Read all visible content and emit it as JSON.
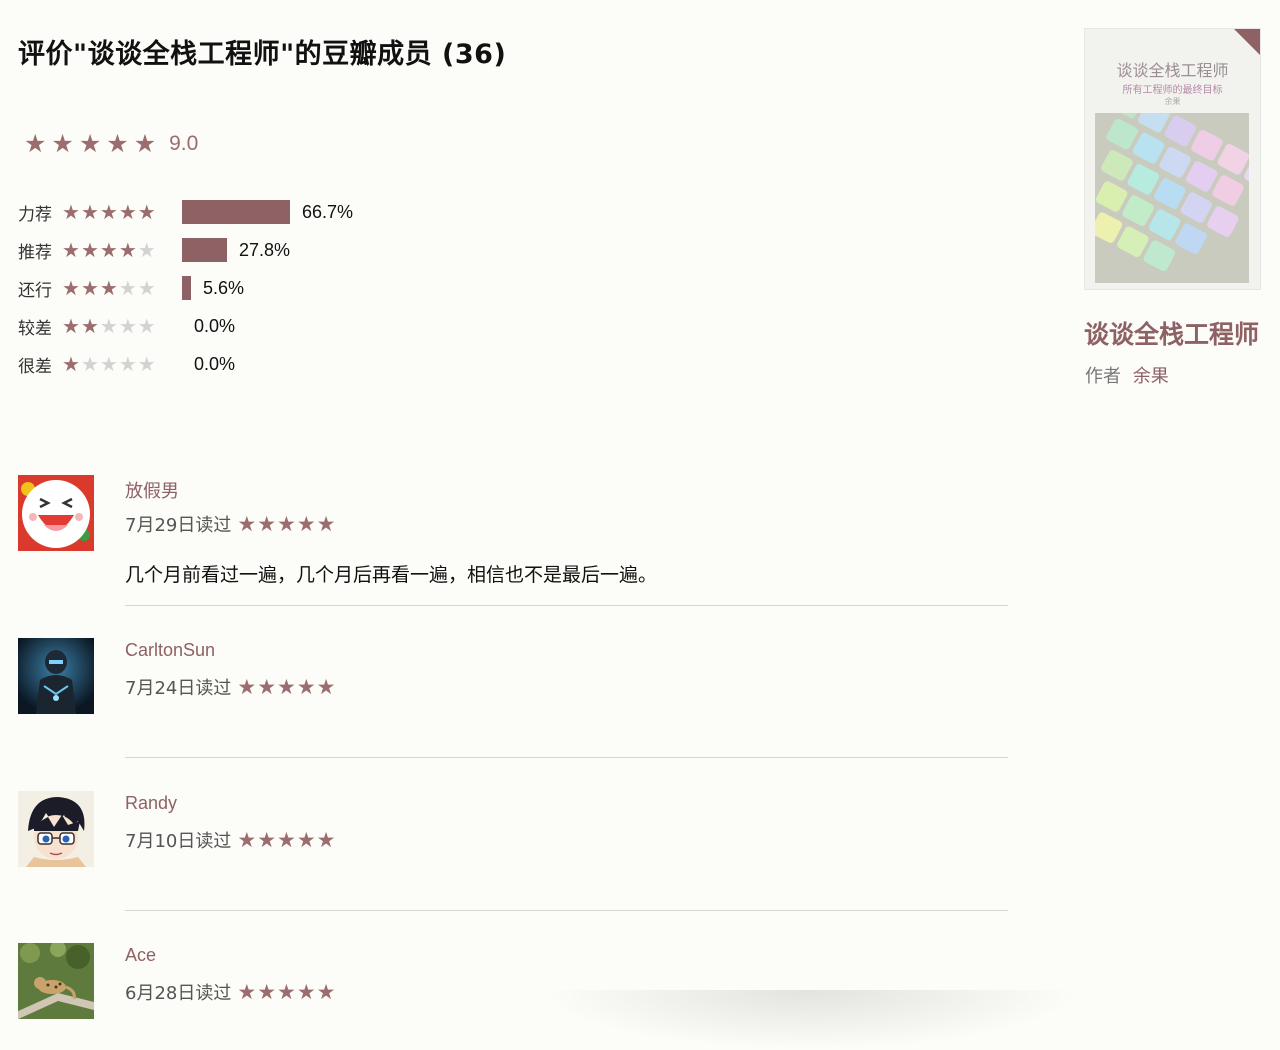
{
  "page": {
    "title": "评价\"谈谈全栈工程师\"的豆瓣成员 (36)"
  },
  "rating": {
    "average": "9.0",
    "average_stars": 5,
    "distribution": [
      {
        "label": "力荐",
        "stars": 5,
        "percent_text": "66.7%",
        "fraction": 0.667
      },
      {
        "label": "推荐",
        "stars": 4,
        "percent_text": "27.8%",
        "fraction": 0.278
      },
      {
        "label": "还行",
        "stars": 3,
        "percent_text": "5.6%",
        "fraction": 0.056
      },
      {
        "label": "较差",
        "stars": 2,
        "percent_text": "0.0%",
        "fraction": 0.0
      },
      {
        "label": "很差",
        "stars": 1,
        "percent_text": "0.0%",
        "fraction": 0.0
      }
    ]
  },
  "reviews": [
    {
      "user": "放假男",
      "date": "7月29日读过",
      "stars": 5,
      "comment": "几个月前看过一遍，几个月后再看一遍，相信也不是最后一遍。",
      "avatar_icon": "laughing-face-avatar"
    },
    {
      "user": "CarltonSun",
      "date": "7月24日读过",
      "stars": 5,
      "comment": "",
      "avatar_icon": "armored-soldier-avatar"
    },
    {
      "user": "Randy",
      "date": "7月10日读过",
      "stars": 5,
      "comment": "",
      "avatar_icon": "anime-boy-avatar"
    },
    {
      "user": "Ace",
      "date": "6月28日读过",
      "stars": 5,
      "comment": "",
      "avatar_icon": "leopard-on-branch-avatar"
    }
  ],
  "book": {
    "cover_title": "谈谈全栈工程师",
    "cover_subtitle": "所有工程师的最终目标",
    "cover_author": "余果",
    "title": "谈谈全栈工程师",
    "author_label": "作者",
    "author": "余果"
  },
  "colors": {
    "accent": "#8e6264",
    "star_on": "#9b6d6f",
    "star_off": "#d3d3d3",
    "background": "#fcfcf8"
  }
}
